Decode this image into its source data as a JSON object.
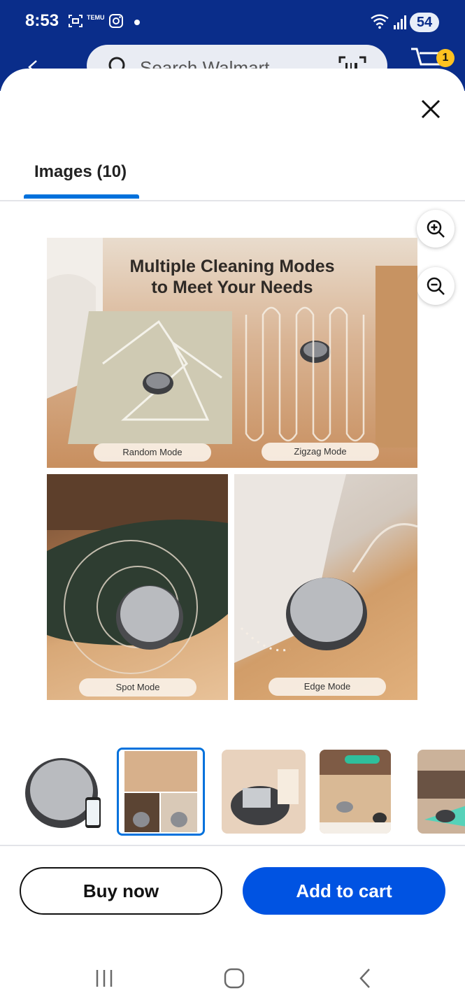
{
  "status_bar": {
    "time": "8:53",
    "battery": "54",
    "temu_label": "TEMU"
  },
  "header": {
    "search_placeholder": "Search Walmart",
    "cart_count": "1"
  },
  "sheet": {
    "tab_label": "Images (10)",
    "main_image": {
      "headline_line1": "Multiple Cleaning Modes",
      "headline_line2": "to Meet Your Needs",
      "labels": [
        "Random Mode",
        "Zigzag Mode",
        "Spot Mode",
        "Edge Mode"
      ]
    },
    "thumbnails": [
      {
        "name": "robot-vacuum-product",
        "selected": false
      },
      {
        "name": "cleaning-modes",
        "selected": true
      },
      {
        "name": "large-dustbin",
        "selected": false
      },
      {
        "name": "smart-voice-control",
        "selected": false
      },
      {
        "name": "obstacle-avoidance",
        "selected": false
      }
    ]
  },
  "actions": {
    "buy_now": "Buy now",
    "add_to_cart": "Add to cart"
  },
  "colors": {
    "walmart_blue": "#0a2d8a",
    "accent_blue": "#0071dc",
    "cart_button": "#0053e2",
    "badge_yellow": "#ffc220"
  }
}
